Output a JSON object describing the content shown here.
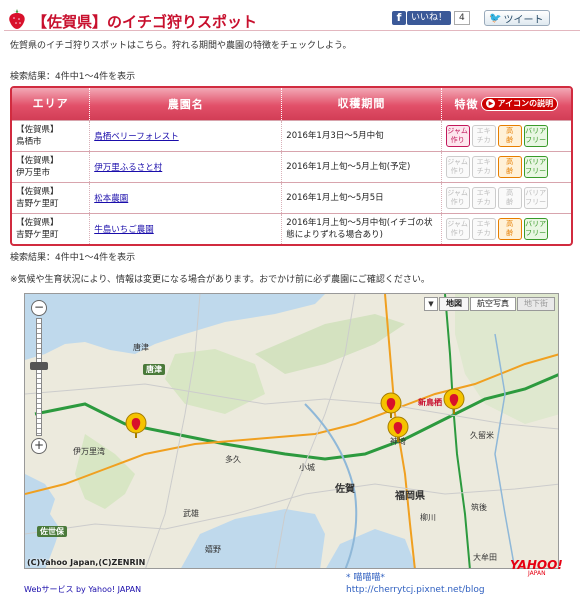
{
  "header": {
    "title": "【佐賀県】のイチゴ狩りスポット",
    "fb_icon": "f",
    "fb_label": "いいね！",
    "fb_count": "4",
    "tweet_label": "ツイート"
  },
  "intro": "佐賀県のイチゴ狩りスポットはこちら。狩れる期間や農園の特徴をチェックしよう。",
  "result_count": "検索結果：4件中1～4件を表示",
  "table": {
    "headers": {
      "area": "エリア",
      "farm": "農園名",
      "period": "収穫期間",
      "feature": "特徴"
    },
    "legend_label": "アイコンの説明",
    "icon_labels": {
      "jam": [
        "ジャム",
        "作り"
      ],
      "eco": [
        "エキ",
        "チカ"
      ],
      "senior": [
        "高",
        "齢"
      ],
      "barrier": [
        "バリア",
        "フリー"
      ]
    },
    "rows": [
      {
        "area1": "【佐賀県】",
        "area2": "鳥栖市",
        "farm": "鳥栖ベリーフォレスト",
        "period": "2016年1月3日～5月中旬",
        "icons": [
          true,
          false,
          true,
          true
        ]
      },
      {
        "area1": "【佐賀県】",
        "area2": "伊万里市",
        "farm": "伊万里ふるさと村",
        "period": "2016年1月上旬～5月上旬(予定)",
        "icons": [
          false,
          false,
          true,
          true
        ]
      },
      {
        "area1": "【佐賀県】",
        "area2": "吉野ケ里町",
        "farm": "松本農園",
        "period": "2016年1月上旬～5月5日",
        "icons": [
          false,
          false,
          false,
          false
        ]
      },
      {
        "area1": "【佐賀県】",
        "area2": "吉野ケ里町",
        "farm": "牛島いちご農園",
        "period": "2016年1月上旬～5月中旬(イチゴの状態によりずれる場合あり)",
        "icons": [
          false,
          false,
          true,
          true
        ]
      }
    ]
  },
  "result_count_bottom": "検索結果：4件中1～4件を表示",
  "note": "※気候や生育状況により、情報は変更になる場合があります。おでかけ前に必ず農園にご確認ください。",
  "map": {
    "type_buttons": {
      "map": "地図",
      "aerial": "航空写真",
      "underground": "地下街"
    },
    "copyright": "(C)Yahoo Japan,(C)ZENRIN",
    "labels": {
      "karatsu": "唐津",
      "saga": "佐賀",
      "fukuoka": "福岡県",
      "imari": "伊万里湾",
      "sasebo": "佐世保",
      "shintosu": "新鳥栖",
      "kanzaki": "神埼",
      "taku": "多久",
      "ogi": "小城",
      "takeo": "武雄",
      "ureshino": "嬉野",
      "kurume": "久留米",
      "chikugo": "筑後",
      "yanagawa": "柳川",
      "omuta": "大牟田"
    }
  },
  "footer": {
    "webservice": "Webサービス by Yahoo! JAPAN",
    "watermark1": "* 喵喵喵*",
    "watermark2": "http://cherrytcj.pixnet.net/blog"
  },
  "colors": {
    "accent": "#c8102e",
    "header_bg": "#e25069"
  }
}
